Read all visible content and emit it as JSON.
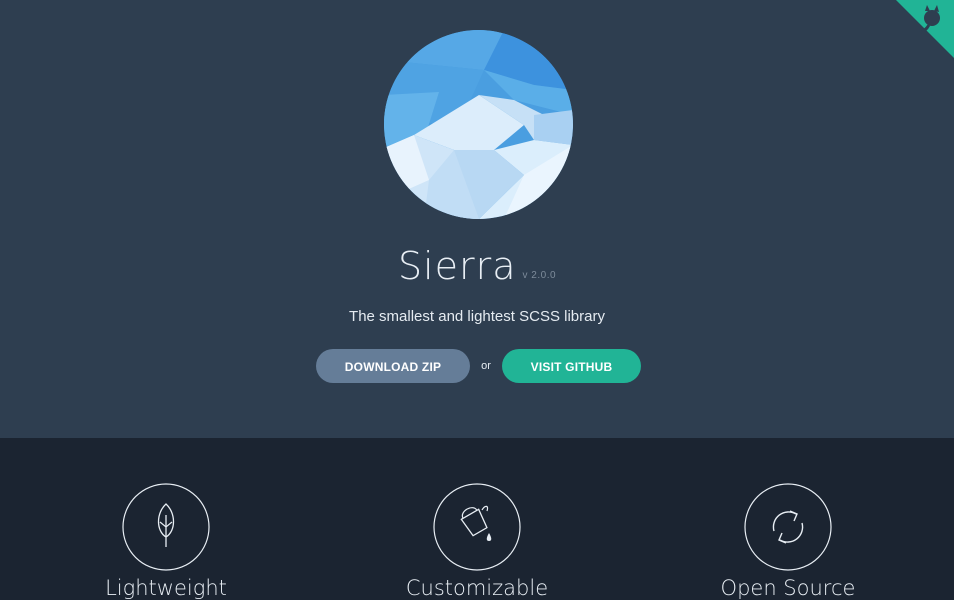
{
  "header": {
    "title": "Sierra",
    "version": "v 2.0.0",
    "tagline": "The smallest and lightest SCSS library"
  },
  "actions": {
    "download_label": "DOWNLOAD ZIP",
    "separator": "or",
    "github_label": "VISIT GITHUB"
  },
  "features": [
    {
      "label": "Lightweight",
      "icon": "leaf-icon"
    },
    {
      "label": "Customizable",
      "icon": "paint-bucket-icon"
    },
    {
      "label": "Open Source",
      "icon": "refresh-arrows-icon"
    }
  ],
  "colors": {
    "hero_bg": "#2e3e50",
    "features_bg": "#1b2431",
    "download_button": "#657d98",
    "github_button": "#21b496",
    "corner_ribbon": "#21b496"
  },
  "corner": {
    "icon": "github-octocat-icon"
  }
}
